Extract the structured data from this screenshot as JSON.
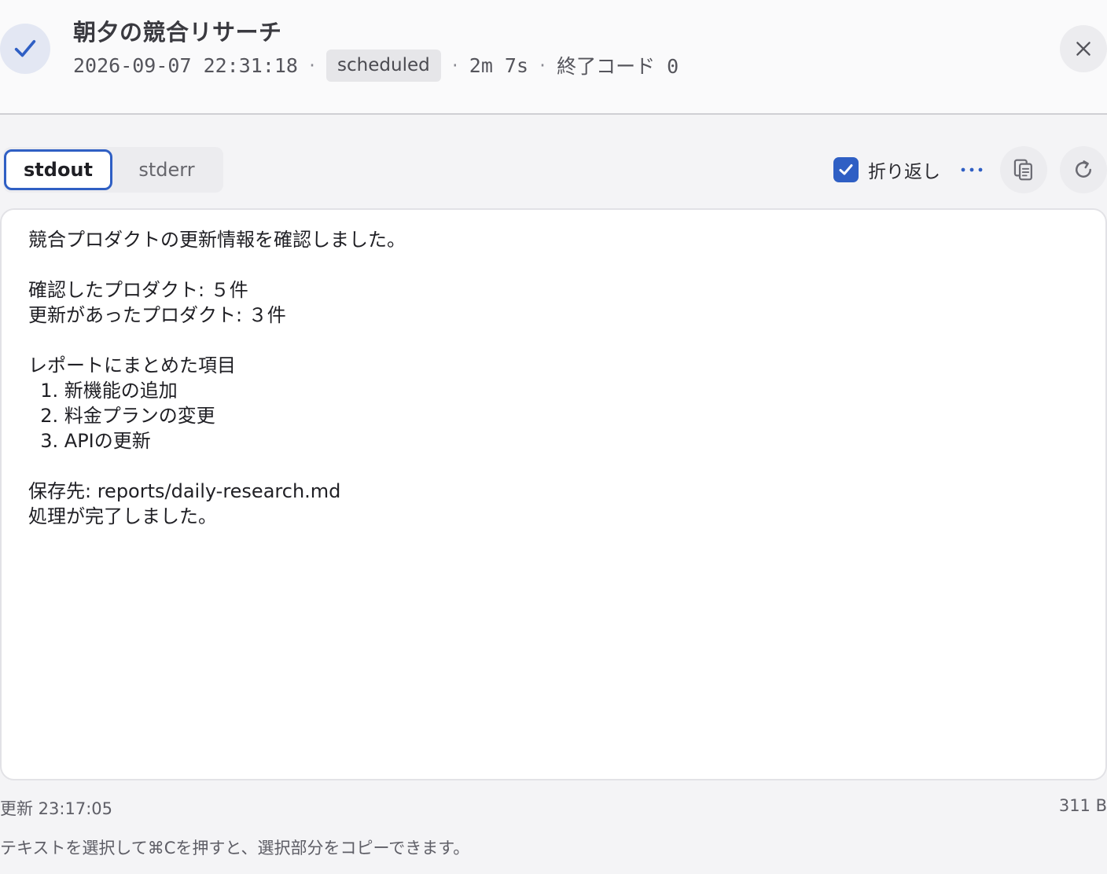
{
  "header": {
    "title": "朝夕の競合リサーチ",
    "timestamp": "2026-09-07 22:31:18",
    "trigger_badge": "scheduled",
    "duration": "2m 7s",
    "exit_code_label": "終了コード 0",
    "separator": "·"
  },
  "tabs": [
    {
      "label": "stdout",
      "active": true
    },
    {
      "label": "stderr",
      "active": false
    }
  ],
  "toolbar": {
    "wrap_label": "折り返し",
    "wrap_checked": true
  },
  "output": {
    "text": "競合プロダクトの更新情報を確認しました。\n\n確認したプロダクト: ５件\n更新があったプロダクト: ３件\n\nレポートにまとめた項目\n  1. 新機能の追加\n  2. 料金プランの変更\n  3. APIの更新\n\n保存先: reports/daily-research.md\n処理が完了しました。"
  },
  "footer": {
    "updated": "更新 23:17:05",
    "size": "311 B",
    "hint": "テキストを選択して⌘Cを押すと、選択部分をコピーできます。"
  },
  "colors": {
    "accent": "#2f5fc4",
    "status_bg": "#e3e7f3"
  },
  "icons": [
    "check-icon",
    "close-icon",
    "checkbox-check-icon",
    "more-icon",
    "copy-icon",
    "refresh-icon"
  ]
}
